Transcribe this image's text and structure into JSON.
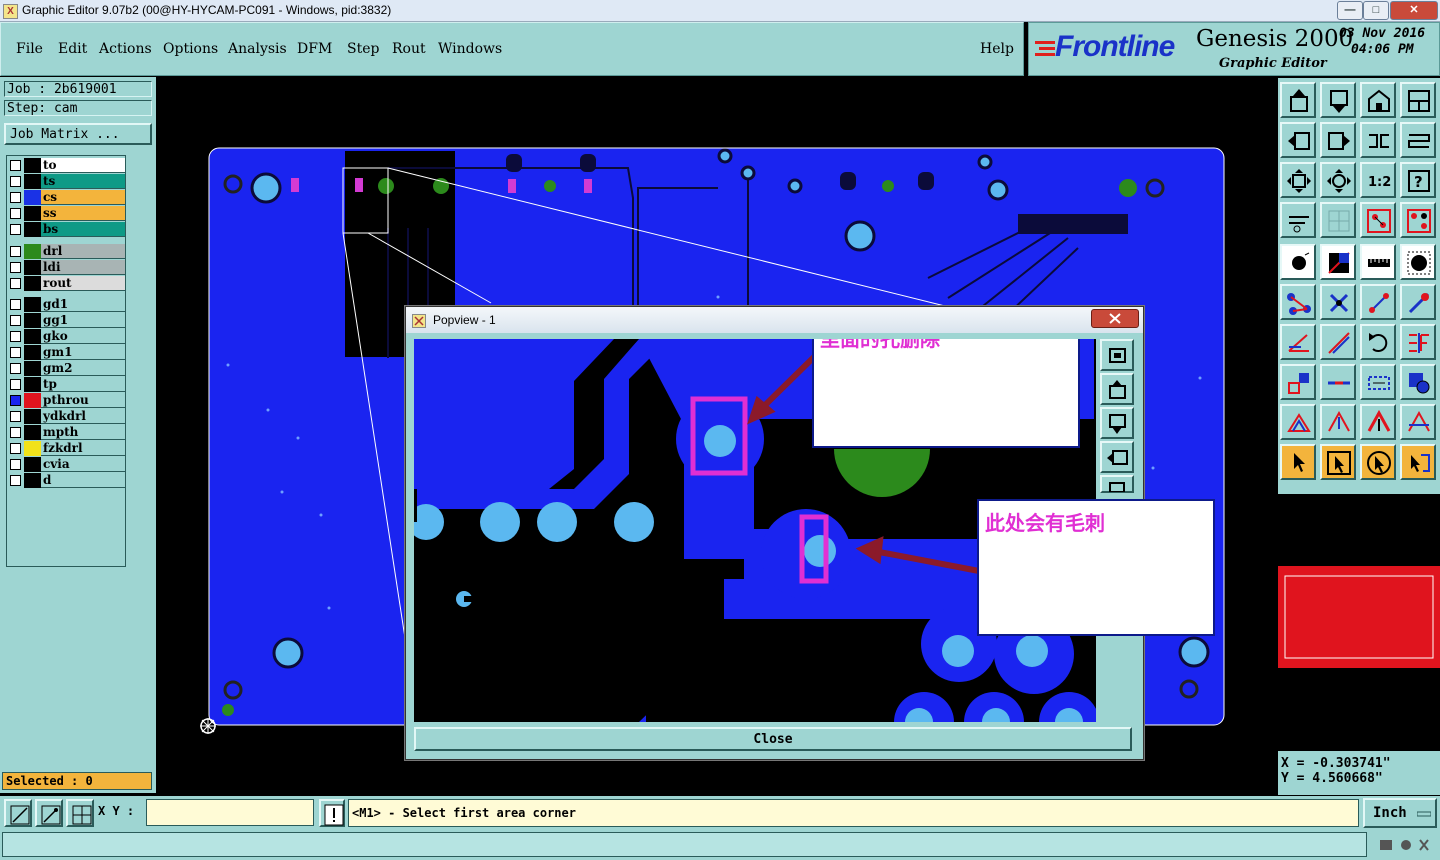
{
  "window": {
    "title": "Graphic Editor 9.07b2 (00@HY-HYCAM-PC091 - Windows, pid:3832)",
    "controls": [
      "—",
      "□",
      "✕"
    ]
  },
  "menu": {
    "items": [
      "File",
      "Edit",
      "Actions",
      "Options",
      "Analysis",
      "DFM",
      "Step",
      "Rout",
      "Windows"
    ],
    "help": "Help"
  },
  "brand": {
    "logo": "Frontline",
    "product": "Genesis 2000",
    "subtitle": "Graphic Editor",
    "date": "03 Nov 2016",
    "time": "04:06 PM"
  },
  "job": {
    "job_label": "Job : 2b619001",
    "step_label": "Step: cam",
    "matrix_button": "Job Matrix ..."
  },
  "layers": [
    {
      "name": "to",
      "swatch": "#000000",
      "bg": "#ffffff"
    },
    {
      "name": "ts",
      "swatch": "#000000",
      "bg": "#0e9a86"
    },
    {
      "name": "cs",
      "swatch": "#1a32e6",
      "bg": "#f3b43c"
    },
    {
      "name": "ss",
      "swatch": "#000000",
      "bg": "#f3b43c"
    },
    {
      "name": "bs",
      "swatch": "#000000",
      "bg": "#0e9a86"
    },
    {
      "name": "drl",
      "swatch": "#2c8a1c",
      "bg": "#a8b4b4"
    },
    {
      "name": "ldi",
      "swatch": "#000000",
      "bg": "#a8b4b4"
    },
    {
      "name": "rout",
      "swatch": "#000000",
      "bg": "#dcdcdc"
    },
    {
      "name": "gd1",
      "swatch": "#000000",
      "bg": "#9ed5d2"
    },
    {
      "name": "gg1",
      "swatch": "#000000",
      "bg": "#9ed5d2"
    },
    {
      "name": "gko",
      "swatch": "#000000",
      "bg": "#9ed5d2"
    },
    {
      "name": "gm1",
      "swatch": "#000000",
      "bg": "#9ed5d2"
    },
    {
      "name": "gm2",
      "swatch": "#000000",
      "bg": "#9ed5d2"
    },
    {
      "name": "tp",
      "swatch": "#000000",
      "bg": "#9ed5d2"
    },
    {
      "name": "pthrou",
      "swatch": "#e0141e",
      "bg": "#9ed5d2"
    },
    {
      "name": "ydkdrl",
      "swatch": "#000000",
      "bg": "#9ed5d2"
    },
    {
      "name": "mpth",
      "swatch": "#000000",
      "bg": "#9ed5d2"
    },
    {
      "name": "fzkdrl",
      "swatch": "#f2e21a",
      "bg": "#9ed5d2"
    },
    {
      "name": "cvia",
      "swatch": "#000000",
      "bg": "#9ed5d2"
    },
    {
      "name": "d",
      "swatch": "#000000",
      "bg": "#9ed5d2"
    }
  ],
  "selected": "Selected : 0",
  "popup": {
    "title": "Popview - 1",
    "close_button": "Close",
    "note1": "里面的孔删除",
    "note2": "此处会有毛刺"
  },
  "coords": {
    "x": "X = -0.303741\"",
    "y": "Y = 4.560668\""
  },
  "bottom": {
    "xy_label": "X Y :",
    "xy_value": "",
    "message": "<M1> - Select first area corner",
    "units": "Inch"
  }
}
